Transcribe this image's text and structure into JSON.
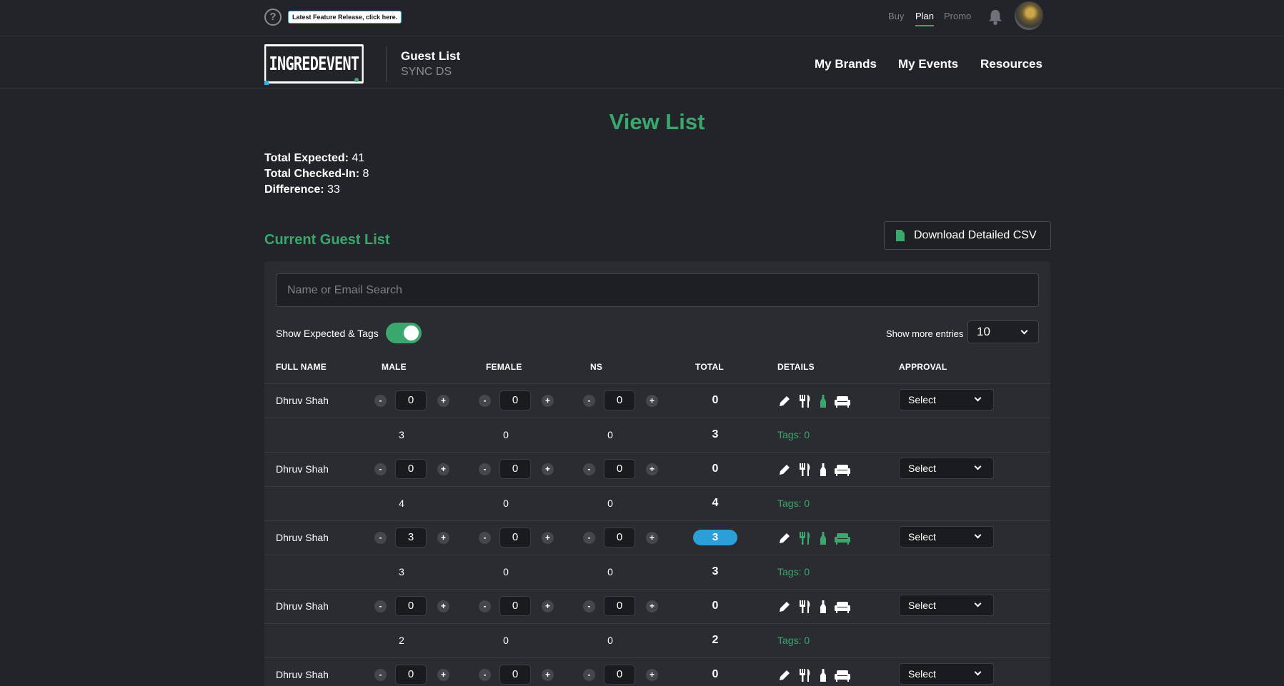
{
  "topbar": {
    "help_glyph": "?",
    "release_badge": "Latest Feature Release, click here.",
    "nav": [
      {
        "label": "Buy",
        "active": false
      },
      {
        "label": "Plan",
        "active": true
      },
      {
        "label": "Promo",
        "active": false
      }
    ]
  },
  "header": {
    "logo_text": "INGREDEVENT",
    "title": "Guest List",
    "subtitle": "SYNC DS",
    "nav": [
      "My Brands",
      "My Events",
      "Resources"
    ]
  },
  "main": {
    "title": "View List",
    "stats": {
      "expected_label": "Total Expected:",
      "expected_value": "41",
      "checkedin_label": "Total Checked-In:",
      "checkedin_value": "8",
      "difference_label": "Difference:",
      "difference_value": "33"
    },
    "section_title": "Current Guest List",
    "csv_button": "Download Detailed CSV",
    "search_placeholder": "Name or Email Search",
    "toggle_label": "Show Expected & Tags",
    "entries_label": "Show more entries",
    "entries_value": "10",
    "columns": [
      "FULL NAME",
      "MALE",
      "FEMALE",
      "NS",
      "TOTAL",
      "DETAILS",
      "APPROVAL"
    ],
    "guests": [
      {
        "name": "Dhruv Shah",
        "male": "0",
        "female": "0",
        "ns": "0",
        "total": "0",
        "highlight": false,
        "expected_male": "3",
        "expected_female": "0",
        "expected_ns": "0",
        "expected_total": "3",
        "tags": "Tags: 0",
        "approval": "Select"
      },
      {
        "name": "Dhruv Shah",
        "male": "0",
        "female": "0",
        "ns": "0",
        "total": "0",
        "highlight": false,
        "expected_male": "4",
        "expected_female": "0",
        "expected_ns": "0",
        "expected_total": "4",
        "tags": "Tags: 0",
        "approval": "Select"
      },
      {
        "name": "Dhruv Shah",
        "male": "3",
        "female": "0",
        "ns": "0",
        "total": "3",
        "highlight": true,
        "expected_male": "3",
        "expected_female": "0",
        "expected_ns": "0",
        "expected_total": "3",
        "tags": "Tags: 0",
        "approval": "Select"
      },
      {
        "name": "Dhruv Shah",
        "male": "0",
        "female": "0",
        "ns": "0",
        "total": "0",
        "highlight": false,
        "expected_male": "2",
        "expected_female": "0",
        "expected_ns": "0",
        "expected_total": "2",
        "tags": "Tags: 0",
        "approval": "Select"
      },
      {
        "name": "Dhruv Shah",
        "male": "0",
        "female": "0",
        "ns": "0",
        "total": "0",
        "highlight": false,
        "approval": "Select"
      }
    ],
    "stepper_minus": "-",
    "stepper_plus": "+"
  },
  "colors": {
    "accent_green": "#3aa76d",
    "accent_blue": "#2a9fd8",
    "background": "#232429",
    "panel": "#2b2c31"
  },
  "icons": {
    "details": [
      "pencil-icon",
      "utensils-icon",
      "bottle-icon",
      "sofa-icon"
    ]
  }
}
